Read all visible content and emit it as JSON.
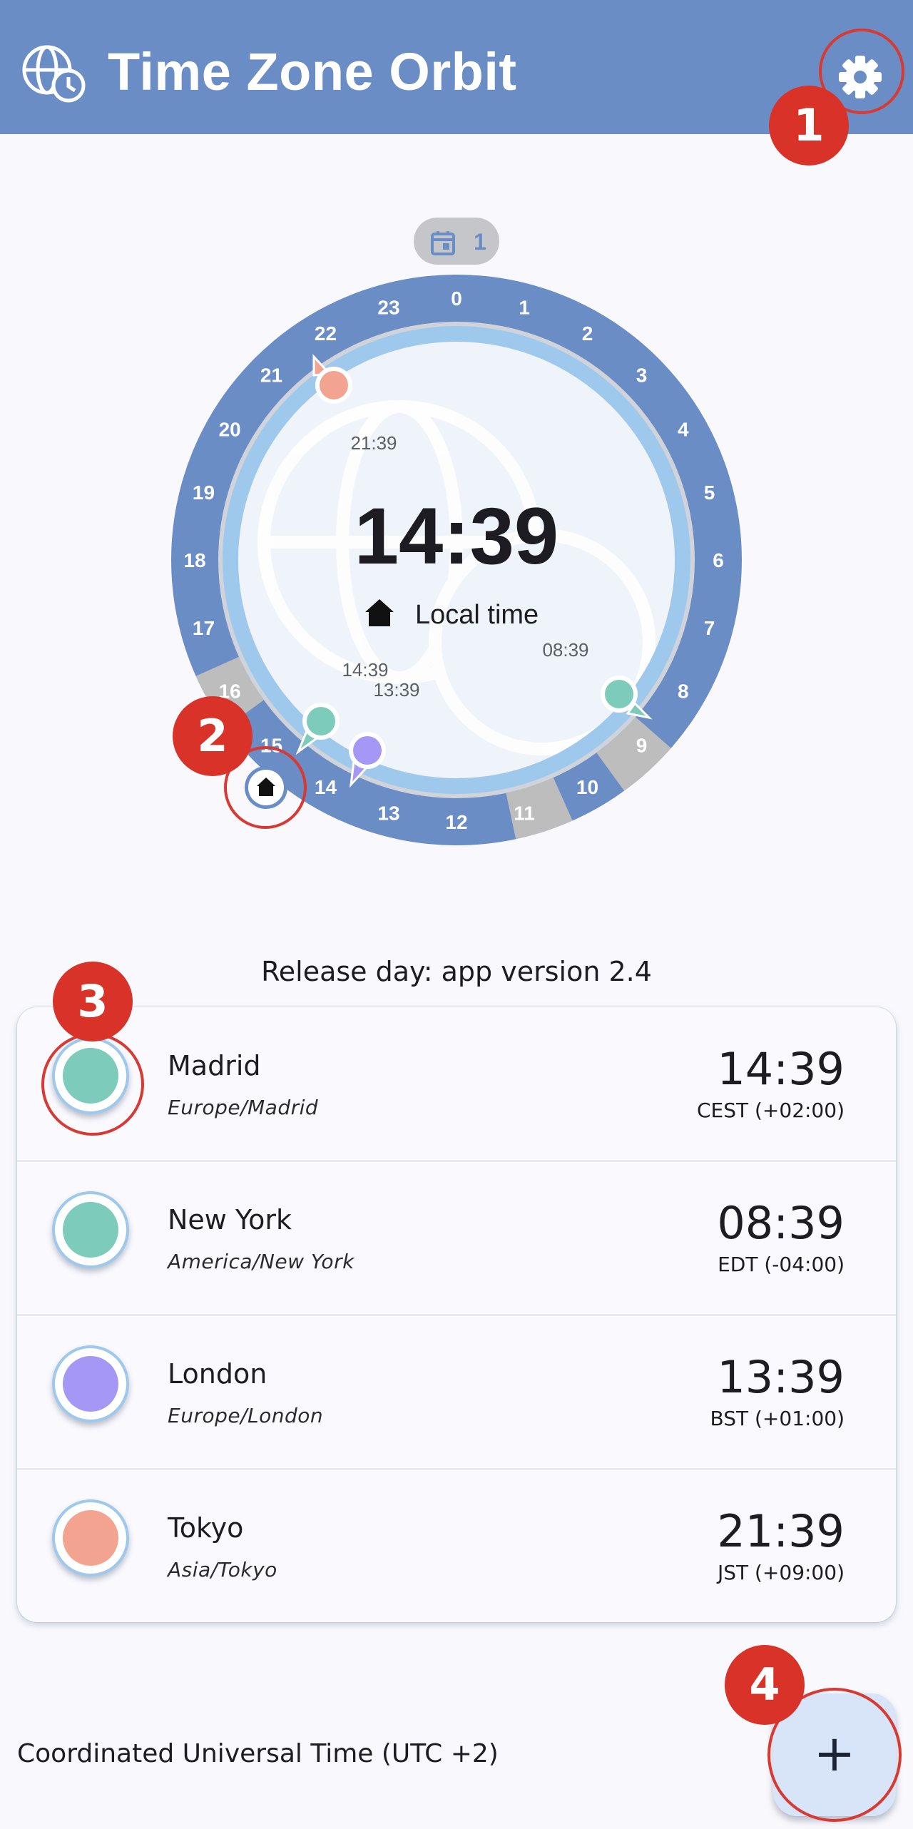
{
  "app": {
    "title": "Time Zone Orbit",
    "icons": {
      "logo": "globe-clock-icon",
      "settings": "gear-icon"
    }
  },
  "dial": {
    "day_badge": "1",
    "center_time": "14:39",
    "center_label": "Local time",
    "hour_labels": [
      "0",
      "1",
      "2",
      "3",
      "4",
      "5",
      "6",
      "7",
      "8",
      "9",
      "10",
      "11",
      "12",
      "13",
      "14",
      "15",
      "16",
      "17",
      "18",
      "19",
      "20",
      "21",
      "22",
      "23"
    ],
    "pin_times": {
      "tokyo": "21:39",
      "new_york": "08:39",
      "madrid": "14:39",
      "london": "13:39"
    }
  },
  "banner": "Release day: app version 2.4",
  "locations": [
    {
      "city": "Madrid",
      "zone": "Europe/Madrid",
      "time": "14:39",
      "abbr": "CEST (+02:00)",
      "color": "#7ccbbb"
    },
    {
      "city": "New York",
      "zone": "America/New York",
      "time": "08:39",
      "abbr": "EDT (-04:00)",
      "color": "#7ccbbb"
    },
    {
      "city": "London",
      "zone": "Europe/London",
      "time": "13:39",
      "abbr": "BST (+01:00)",
      "color": "#a597f5"
    },
    {
      "city": "Tokyo",
      "zone": "Asia/Tokyo",
      "time": "21:39",
      "abbr": "JST (+09:00)",
      "color": "#f3a491"
    }
  ],
  "footer": {
    "utc_label": "Coordinated Universal Time (UTC +2)",
    "fab_icon": "+"
  },
  "annotations": [
    "1",
    "2",
    "3",
    "4"
  ],
  "colors": {
    "appbar": "#6a8dc6",
    "annotation": "#d93228",
    "ring_outer": "#6a8dc6",
    "ring_inner": "#9ec8ec"
  }
}
